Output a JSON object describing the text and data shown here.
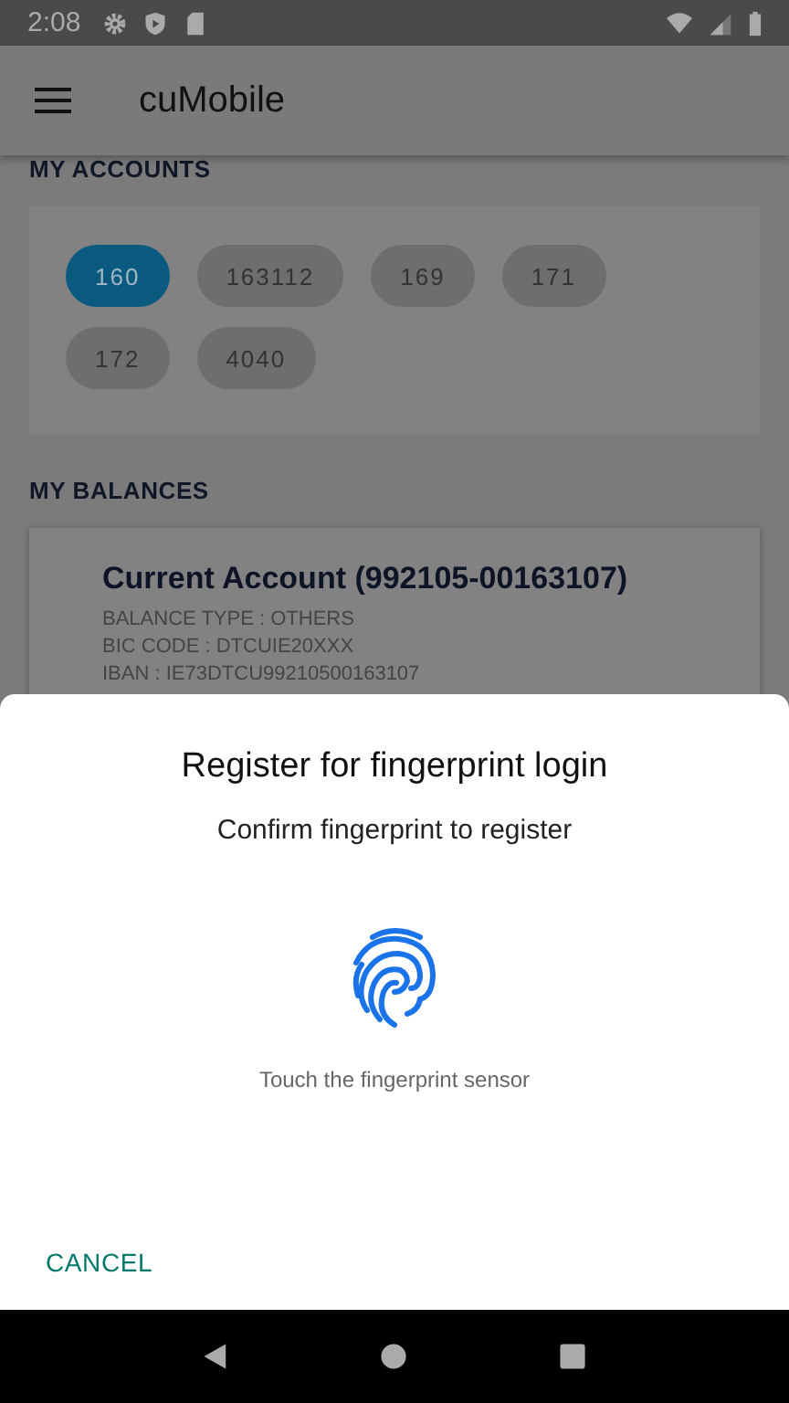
{
  "status_bar": {
    "time": "2:08"
  },
  "app_bar": {
    "title": "cuMobile"
  },
  "accounts": {
    "heading": "MY ACCOUNTS",
    "chips": [
      {
        "label": "160",
        "selected": true
      },
      {
        "label": "163112",
        "selected": false
      },
      {
        "label": "169",
        "selected": false
      },
      {
        "label": "171",
        "selected": false
      },
      {
        "label": "172",
        "selected": false
      },
      {
        "label": "4040",
        "selected": false
      }
    ]
  },
  "balances": {
    "heading": "MY BALANCES",
    "card": {
      "title": "Current Account (992105-00163107)",
      "lines": [
        "BALANCE TYPE : OTHERS",
        "BIC CODE : DTCUIE20XXX",
        "IBAN : IE73DTCU99210500163107"
      ]
    }
  },
  "dialog": {
    "title": "Register for fingerprint login",
    "subtitle": "Confirm fingerprint to register",
    "hint": "Touch the fingerprint sensor",
    "cancel": "CANCEL"
  }
}
